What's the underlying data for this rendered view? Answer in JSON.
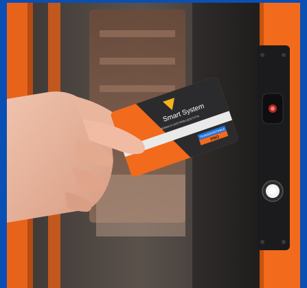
{
  "image": {
    "description_tags": [
      "hand",
      "access-card",
      "card-reader",
      "door-frame"
    ],
    "card": {
      "brand": "Smart System",
      "tagline": "ЗАМКИ И СИСТЕМЫ ДОСТУПА",
      "badge_top": "TRANSPORTABLE",
      "badge_bottom": "PRO",
      "colors": {
        "orange": "#f26a1b",
        "dark": "#2b2b2e",
        "stripe": "#e9e9e9",
        "badge_blue": "#1e6fd9",
        "logo_gold": "#f5b21a"
      }
    },
    "colors": {
      "border_blue": "#0a4fb3",
      "door_orange": "#f26a1b",
      "panel_black": "#1b1b1d",
      "skin": "#e7b39a"
    }
  }
}
